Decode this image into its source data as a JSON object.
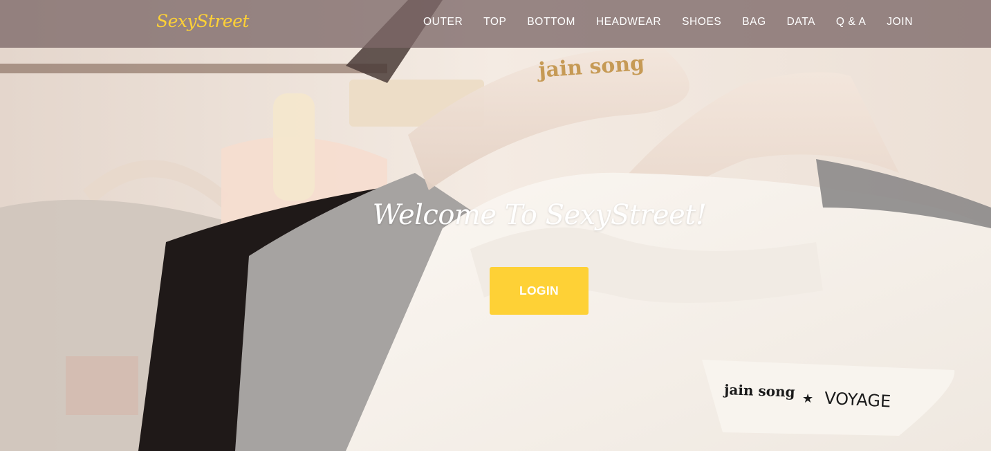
{
  "brand": {
    "name": "SexyStreet",
    "color": "#fed136"
  },
  "nav": {
    "items": [
      {
        "label": "OUTER"
      },
      {
        "label": "TOP"
      },
      {
        "label": "BOTTOM"
      },
      {
        "label": "HEADWEAR"
      },
      {
        "label": "SHOES"
      },
      {
        "label": "BAG"
      },
      {
        "label": "DATA"
      },
      {
        "label": "Q & A"
      },
      {
        "label": "JOIN"
      }
    ]
  },
  "hero": {
    "heading": "Welcome To SexyStreet!",
    "login_label": "LOGIN",
    "accent_color": "#fed136",
    "background_photo": {
      "hanger_brand": "jain song",
      "label_brand": "jain song",
      "label_star": "★",
      "label_collab": "VOYAGE"
    }
  }
}
